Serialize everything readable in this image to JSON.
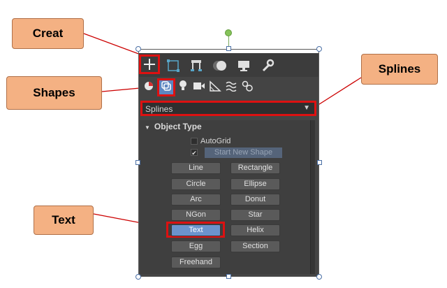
{
  "callouts": {
    "creat": "Creat",
    "shapes": "Shapes",
    "splines": "Splines",
    "text": "Text"
  },
  "toolbar": {
    "tabs": [
      "create-icon",
      "modify-icon",
      "hierarchy-icon",
      "motion-icon",
      "display-icon",
      "utilities-icon"
    ],
    "sub_icons": [
      "geometry-icon",
      "shapes-icon",
      "lights-icon",
      "cameras-icon",
      "helpers-icon",
      "spacewarps-icon",
      "systems-icon"
    ]
  },
  "dropdown": {
    "selected": "Splines",
    "arrow": "▼"
  },
  "rollout": {
    "title": "Object Type",
    "collapse_glyph": "▼",
    "autogrid": {
      "label": "AutoGrid",
      "checked": false
    },
    "start_new_shape": {
      "label": "Start New Shape",
      "checked": true,
      "check_glyph": "✔"
    }
  },
  "buttons": [
    [
      "Line",
      "Rectangle"
    ],
    [
      "Circle",
      "Ellipse"
    ],
    [
      "Arc",
      "Donut"
    ],
    [
      "NGon",
      "Star"
    ],
    [
      "Text",
      "Helix"
    ],
    [
      "Egg",
      "Section"
    ],
    [
      "Freehand"
    ]
  ],
  "active_button": "Text",
  "colors": {
    "highlight": "#dd1111",
    "callout_fill": "#f4b183",
    "active_button": "#6b93cc"
  }
}
